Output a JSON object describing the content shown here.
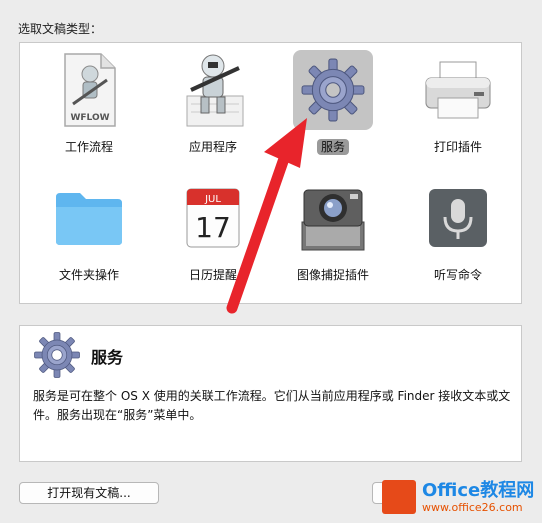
{
  "header": {
    "label": "选取文稿类型："
  },
  "types": [
    {
      "label": "工作流程",
      "selected": false,
      "icon": "workflow-file-icon",
      "icon_text": "WFLOW"
    },
    {
      "label": "应用程序",
      "selected": false,
      "icon": "automator-robot-icon"
    },
    {
      "label": "服务",
      "selected": true,
      "icon": "gear-icon"
    },
    {
      "label": "打印插件",
      "selected": false,
      "icon": "printer-icon"
    },
    {
      "label": "文件夹操作",
      "selected": false,
      "icon": "folder-icon"
    },
    {
      "label": "日历提醒",
      "selected": false,
      "icon": "calendar-icon",
      "icon_month": "JUL",
      "icon_day": "17"
    },
    {
      "label": "图像捕捉插件",
      "selected": false,
      "icon": "camera-icon"
    },
    {
      "label": "听写命令",
      "selected": false,
      "icon": "microphone-icon"
    }
  ],
  "description": {
    "title": "服务",
    "icon": "gear-icon",
    "text": "服务是可在整个 OS X 使用的关联工作流程。它们从当前应用程序或 Finder 接收文本或文件。服务出现在“服务”菜单中。"
  },
  "buttons": {
    "open_existing": "打开现有文稿..."
  },
  "watermark": {
    "brand": "Office教程网",
    "url": "www.office26.com"
  },
  "colors": {
    "arrow": "#e8242b",
    "selection": "#c4c4c4",
    "label_highlight": "#9a9a9a"
  }
}
